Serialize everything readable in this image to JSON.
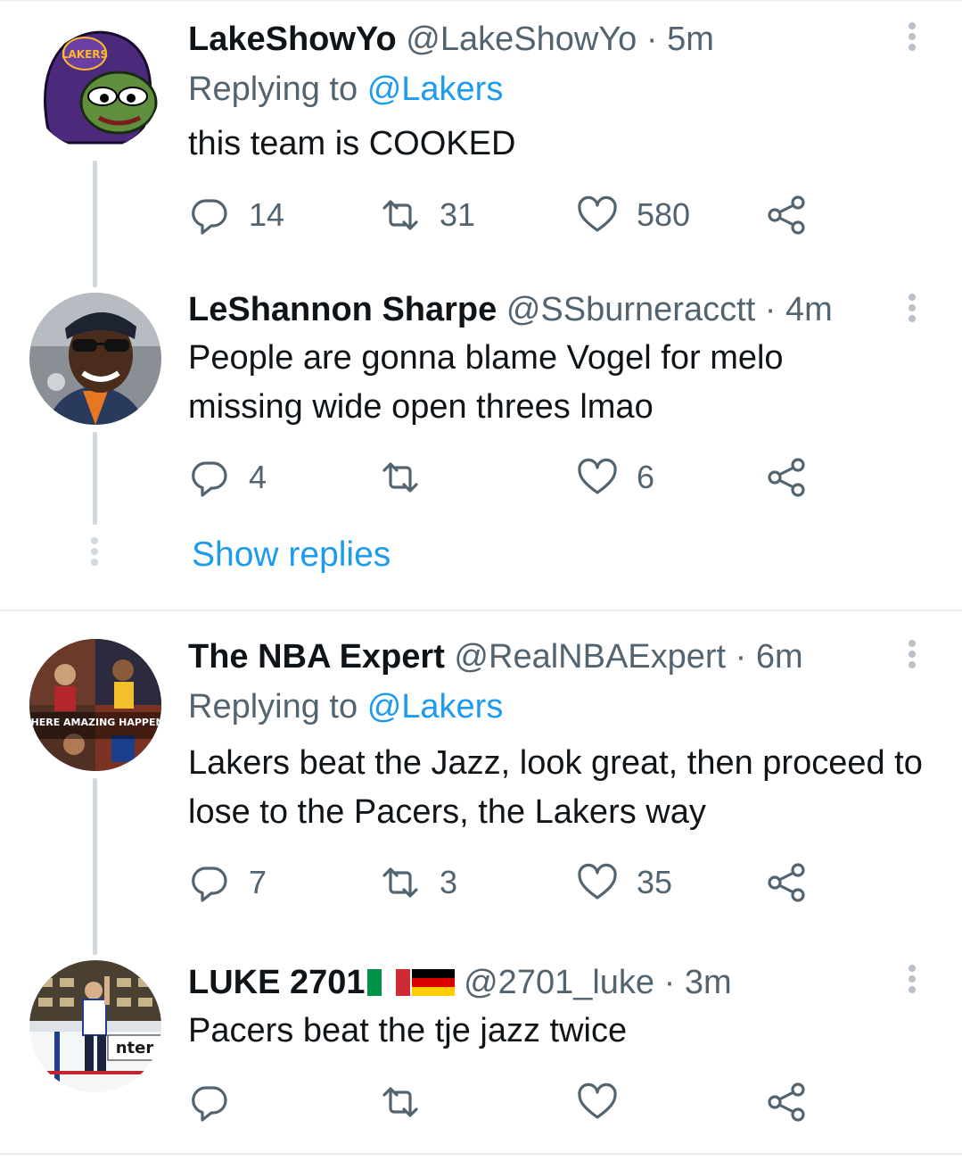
{
  "colors": {
    "link": "#1d9bf0",
    "secondary": "#536471",
    "primary_text": "#0f1419",
    "thread_line": "#cfd9de"
  },
  "tweets": [
    {
      "name": "LakeShowYo",
      "handle": "@LakeShowYo",
      "separator": "·",
      "time": "5m",
      "replying_prefix": "Replying to",
      "replying_to": "@Lakers",
      "text": "this team is COOKED",
      "replies": "14",
      "retweets": "31",
      "likes": "580",
      "avatar_badge": "LAKERS"
    },
    {
      "name": "LeShannon Sharpe",
      "handle": "@SSburneracctt",
      "separator": "·",
      "time": "4m",
      "text": "People are gonna blame Vogel for melo missing wide open threes lmao",
      "replies": "4",
      "retweets": "",
      "likes": "6"
    },
    {
      "name": "The NBA Expert",
      "handle": "@RealNBAExpert",
      "separator": "·",
      "time": "6m",
      "replying_prefix": "Replying to",
      "replying_to": "@Lakers",
      "text": "Lakers beat the Jazz, look great, then proceed to lose to the Pacers, the Lakers way",
      "replies": "7",
      "retweets": "3",
      "likes": "35",
      "avatar_text": "WHERE AMAZING HAPPENS"
    },
    {
      "name": "LUKE 2701",
      "flags": [
        "italy-flag-icon",
        "germany-flag-icon"
      ],
      "handle": "@2701_luke",
      "separator": "·",
      "time": "3m",
      "text": "Pacers beat the tje jazz twice",
      "replies": "",
      "retweets": "",
      "likes": "",
      "avatar_text": "nter"
    }
  ],
  "show_replies": "Show replies"
}
